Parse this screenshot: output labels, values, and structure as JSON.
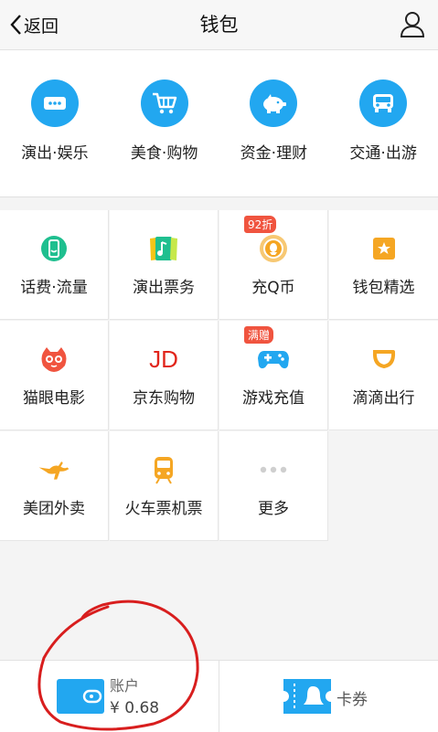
{
  "header": {
    "back_label": "返回",
    "title": "钱包",
    "user_icon": "user-icon"
  },
  "top_categories": [
    {
      "label": "演出·娱乐",
      "icon": "ticket-icon"
    },
    {
      "label": "美食·购物",
      "icon": "cart-icon"
    },
    {
      "label": "资金·理财",
      "icon": "piggy-bank-icon"
    },
    {
      "label": "交通·出游",
      "icon": "car-icon"
    }
  ],
  "grid": [
    {
      "label": "话费·流量",
      "icon": "phone-icon",
      "color": "#1fbf8f"
    },
    {
      "label": "演出票务",
      "icon": "ticket-music-icon",
      "color": "#1fbf8f"
    },
    {
      "label": "充Q币",
      "icon": "q-coin-icon",
      "color": "#f5a623",
      "badge": "92折"
    },
    {
      "label": "钱包精选",
      "icon": "star-tag-icon",
      "color": "#f5a623"
    },
    {
      "label": "猫眼电影",
      "icon": "cat-eye-icon",
      "color": "#f0543f"
    },
    {
      "label": "京东购物",
      "icon": "jd-icon",
      "color": "#e1251b",
      "icon_text": "JD"
    },
    {
      "label": "游戏充值",
      "icon": "gamepad-icon",
      "color": "#22a7f0",
      "badge": "满赠"
    },
    {
      "label": "滴滴出行",
      "icon": "didi-icon",
      "color": "#f5a623"
    },
    {
      "label": "美团外卖",
      "icon": "kangaroo-icon",
      "color": "#f5a623"
    },
    {
      "label": "火车票机票",
      "icon": "train-icon",
      "color": "#f5a623"
    },
    {
      "label": "更多",
      "icon": "more-dots-icon",
      "color": "#cccccc"
    }
  ],
  "bottom": {
    "account_label": "账户",
    "account_value": "¥ 0.68",
    "coupon_label": "卡券"
  },
  "colors": {
    "accent": "#22a7f0",
    "annotation": "#d81e1e"
  }
}
